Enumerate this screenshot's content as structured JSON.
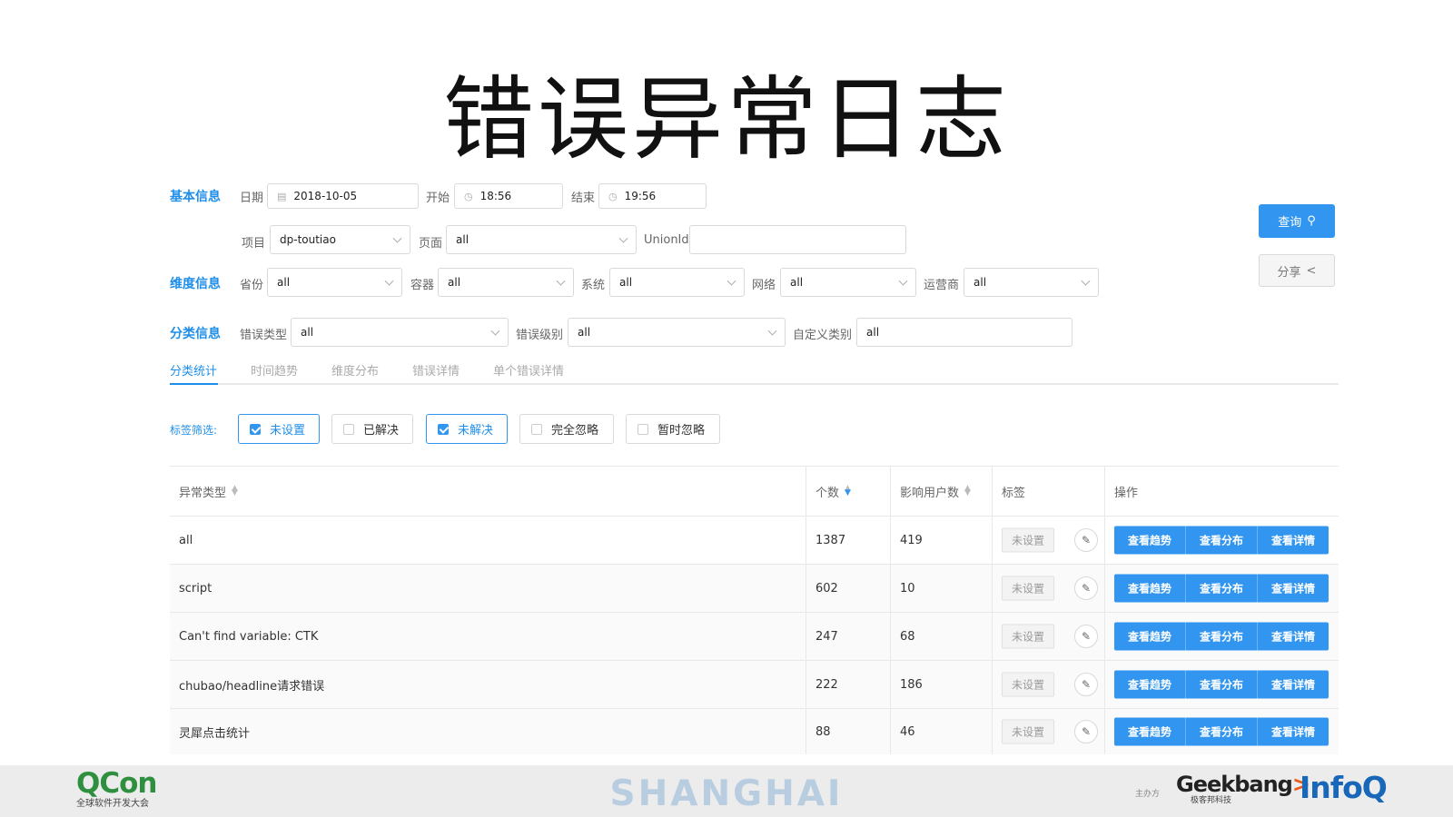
{
  "slide_title": "错误异常日志",
  "sections": {
    "basic": "基本信息",
    "dimension": "维度信息",
    "category": "分类信息"
  },
  "basic": {
    "date_label": "日期",
    "date_value": "2018-10-05",
    "start_label": "开始",
    "start_value": "18:56",
    "end_label": "结束",
    "end_value": "19:56",
    "project_label": "项目",
    "project_value": "dp-toutiao",
    "page_label": "页面",
    "page_value": "all",
    "unionid_label": "UnionId",
    "unionid_value": ""
  },
  "dimension": [
    {
      "label": "省份",
      "value": "all"
    },
    {
      "label": "容器",
      "value": "all"
    },
    {
      "label": "系统",
      "value": "all"
    },
    {
      "label": "网络",
      "value": "all"
    },
    {
      "label": "运营商",
      "value": "all"
    }
  ],
  "category": {
    "type_label": "错误类型",
    "type_value": "all",
    "level_label": "错误级别",
    "level_value": "all",
    "custom_label": "自定义类别",
    "custom_value": "all"
  },
  "actions": {
    "query": "查询",
    "share": "分享"
  },
  "icons": {
    "date": "calendar-icon",
    "time": "clock-icon",
    "query": "search-icon",
    "share": "share-icon",
    "edit": "pencil-icon"
  },
  "tabs": [
    "分类统计",
    "时间趋势",
    "维度分布",
    "错误详情",
    "单个错误详情"
  ],
  "active_tab": "分类统计",
  "filter": {
    "label": "标签筛选:",
    "options": [
      {
        "label": "未设置",
        "checked": true
      },
      {
        "label": "已解决",
        "checked": false
      },
      {
        "label": "未解决",
        "checked": true
      },
      {
        "label": "完全忽略",
        "checked": false
      },
      {
        "label": "暂时忽略",
        "checked": false
      }
    ]
  },
  "table": {
    "headers": [
      "异常类型",
      "个数",
      "影响用户数",
      "标签",
      "操作"
    ],
    "rows": [
      {
        "type": "all",
        "count": "1387",
        "users": "419",
        "tag": "未设置"
      },
      {
        "type": "script",
        "count": "602",
        "users": "10",
        "tag": "未设置"
      },
      {
        "type": "Can't find variable: CTK",
        "count": "247",
        "users": "68",
        "tag": "未设置"
      },
      {
        "type": "chubao/headline请求错误",
        "count": "222",
        "users": "186",
        "tag": "未设置"
      },
      {
        "type": "灵犀点击统计",
        "count": "88",
        "users": "46",
        "tag": "未设置"
      }
    ],
    "row_actions": [
      "查看趋势",
      "查看分布",
      "查看详情"
    ]
  },
  "footer": {
    "qcon": "QCon",
    "qcon_sub": "全球软件开发大会",
    "city": "SHANGHAI",
    "sponsor": "主办方",
    "geek": "Geekbang",
    "geek_sub": "极客邦科技",
    "infoq": "InfoQ"
  },
  "colors": {
    "accent": "#1f8ee9",
    "button": "#3296f0",
    "qcon_green": "#2e8f3e",
    "infoq_blue": "#1967b8"
  }
}
